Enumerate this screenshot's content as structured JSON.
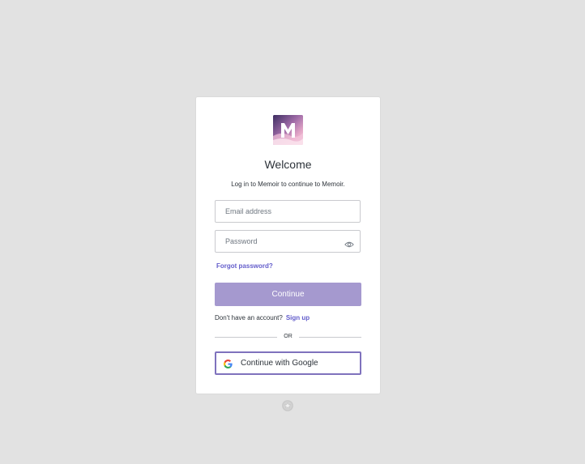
{
  "card": {
    "logo_letter": "M",
    "title": "Welcome",
    "subtitle": "Log in to Memoir to continue to Memoir."
  },
  "form": {
    "email_placeholder": "Email address",
    "password_placeholder": "Password",
    "forgot_label": "Forgot password?",
    "continue_label": "Continue"
  },
  "signup": {
    "prompt": "Don't have an account?",
    "link_label": "Sign up"
  },
  "divider": {
    "text": "OR"
  },
  "social": {
    "google_label": "Continue with Google"
  },
  "colors": {
    "background": "#e2e2e2",
    "accent": "#635dcb",
    "continue_button": "#a599cf",
    "google_border": "#7f72bd"
  },
  "icons": {
    "logo": "memoir-logo-icon",
    "password_toggle": "eye-icon",
    "google": "google-icon",
    "badge": "star-badge-icon"
  }
}
